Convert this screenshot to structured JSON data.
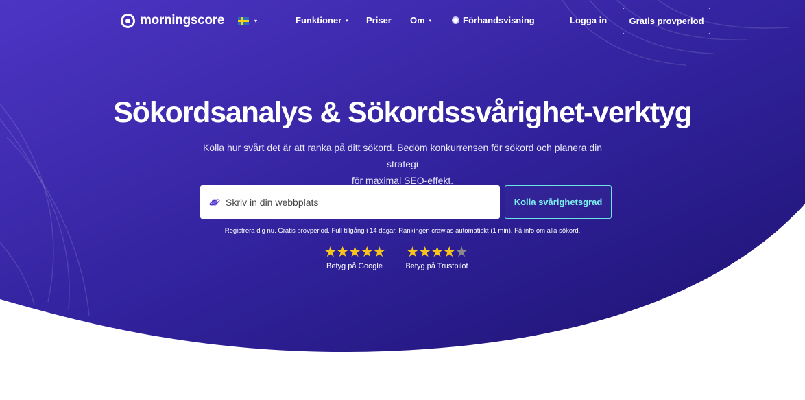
{
  "brand": {
    "name": "morningscore"
  },
  "language": {
    "flag": "sweden-flag-icon",
    "caret": "▾"
  },
  "nav": {
    "features": "Funktioner",
    "pricing": "Priser",
    "about": "Om",
    "preview": "Förhandsvisning",
    "login": "Logga in",
    "trial": "Gratis provperiod",
    "caret": "▾"
  },
  "hero": {
    "title": "Sökordsanalys & Sökordssvårighet-verktyg",
    "subtitle_line1": "Kolla hur svårt det är att ranka på ditt sökord. Bedöm konkurrensen för sökord och planera din strategi",
    "subtitle_line2": "för maximal SEO-effekt.",
    "search_placeholder": "Skriv in din webbplats",
    "search_button": "Kolla svårighetsgrad",
    "note": "Registrera dig nu. Gratis provperiod. Full tillgång i 14 dagar. Rankingen crawlas automatiskt (1 min). Få info om alla sökord."
  },
  "ratings": [
    {
      "label": "Betyg på Google",
      "stars": 5,
      "max": 5
    },
    {
      "label": "Betyg på Trustpilot",
      "stars": 4,
      "max": 5
    }
  ],
  "colors": {
    "bg_gradient_start": "#4b33c0",
    "bg_gradient_end": "#211677",
    "accent_cyan": "#6ee4e6",
    "star": "#f8c51c"
  }
}
